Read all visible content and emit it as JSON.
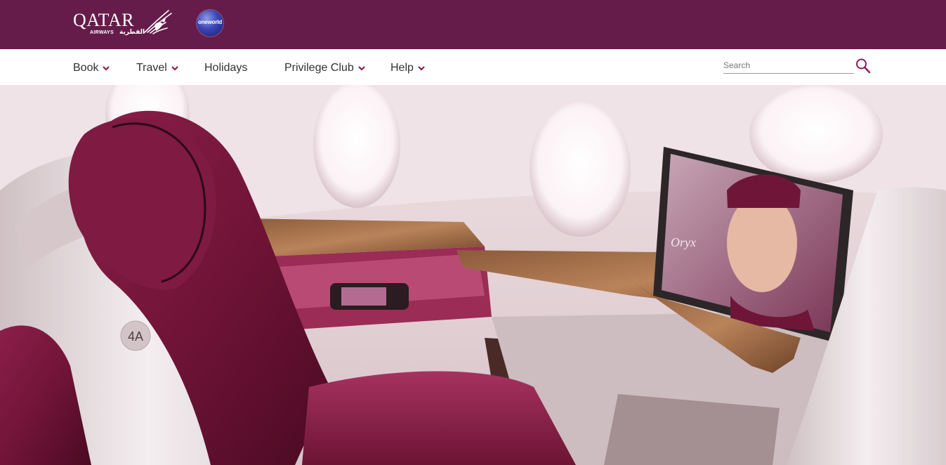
{
  "brand": {
    "name": "QATAR",
    "sub": "AIRWAYS",
    "arabic": "القطرية",
    "alliance": "oneworld",
    "bar_color": "#661c4a"
  },
  "nav": {
    "items": [
      {
        "label": "Book",
        "dropdown": true
      },
      {
        "label": "Travel",
        "dropdown": true
      },
      {
        "label": "Holidays",
        "dropdown": false
      },
      {
        "label": "Privilege Club",
        "dropdown": true
      },
      {
        "label": "Help",
        "dropdown": true
      }
    ],
    "accent": "#8a1b5a"
  },
  "search": {
    "placeholder": "Search",
    "value": "",
    "icon": "search-icon"
  },
  "hero": {
    "seat_label": "4A",
    "screen_text": "Oryx",
    "icons": [
      "seat-illustration",
      "window",
      "entertainment-screen"
    ]
  }
}
